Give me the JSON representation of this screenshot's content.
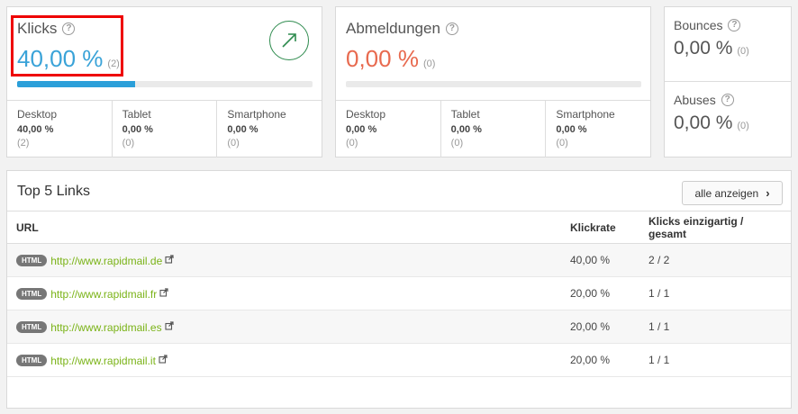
{
  "klicks": {
    "title": "Klicks",
    "value": "40,00 %",
    "count": "(2)",
    "progress": 0.4,
    "devices": [
      {
        "name": "Desktop",
        "percent": "40,00 %",
        "count": "(2)"
      },
      {
        "name": "Tablet",
        "percent": "0,00 %",
        "count": "(0)"
      },
      {
        "name": "Smartphone",
        "percent": "0,00 %",
        "count": "(0)"
      }
    ]
  },
  "abmeldungen": {
    "title": "Abmeldungen",
    "value": "0,00 %",
    "count": "(0)",
    "progress": 0,
    "devices": [
      {
        "name": "Desktop",
        "percent": "0,00 %",
        "count": "(0)"
      },
      {
        "name": "Tablet",
        "percent": "0,00 %",
        "count": "(0)"
      },
      {
        "name": "Smartphone",
        "percent": "0,00 %",
        "count": "(0)"
      }
    ]
  },
  "bounces": {
    "title": "Bounces",
    "value": "0,00 %",
    "count": "(0)"
  },
  "abuses": {
    "title": "Abuses",
    "value": "0,00 %",
    "count": "(0)"
  },
  "links": {
    "title": "Top 5 Links",
    "show_all": "alle anzeigen",
    "columns": [
      "URL",
      "Klickrate",
      "Klicks einzigartig / gesamt"
    ],
    "badge": "HTML",
    "rows": [
      {
        "url": "http://www.rapidmail.de",
        "rate": "40,00 %",
        "clicks": "2 / 2"
      },
      {
        "url": "http://www.rapidmail.fr",
        "rate": "20,00 %",
        "clicks": "1 / 1"
      },
      {
        "url": "http://www.rapidmail.es",
        "rate": "20,00 %",
        "clicks": "1 / 1"
      },
      {
        "url": "http://www.rapidmail.it",
        "rate": "20,00 %",
        "clicks": "1 / 1"
      }
    ]
  },
  "colors": {
    "accent_blue": "#3aa3d8",
    "accent_red": "#e86a4f",
    "link_green": "#7ab317",
    "trend_green": "#2e8b4e",
    "highlight": "#ee0000"
  },
  "icons": {
    "help": "question-circle-icon",
    "trend": "arrow-up-right-icon",
    "external": "external-link-icon",
    "chevron": "chevron-right-icon"
  }
}
